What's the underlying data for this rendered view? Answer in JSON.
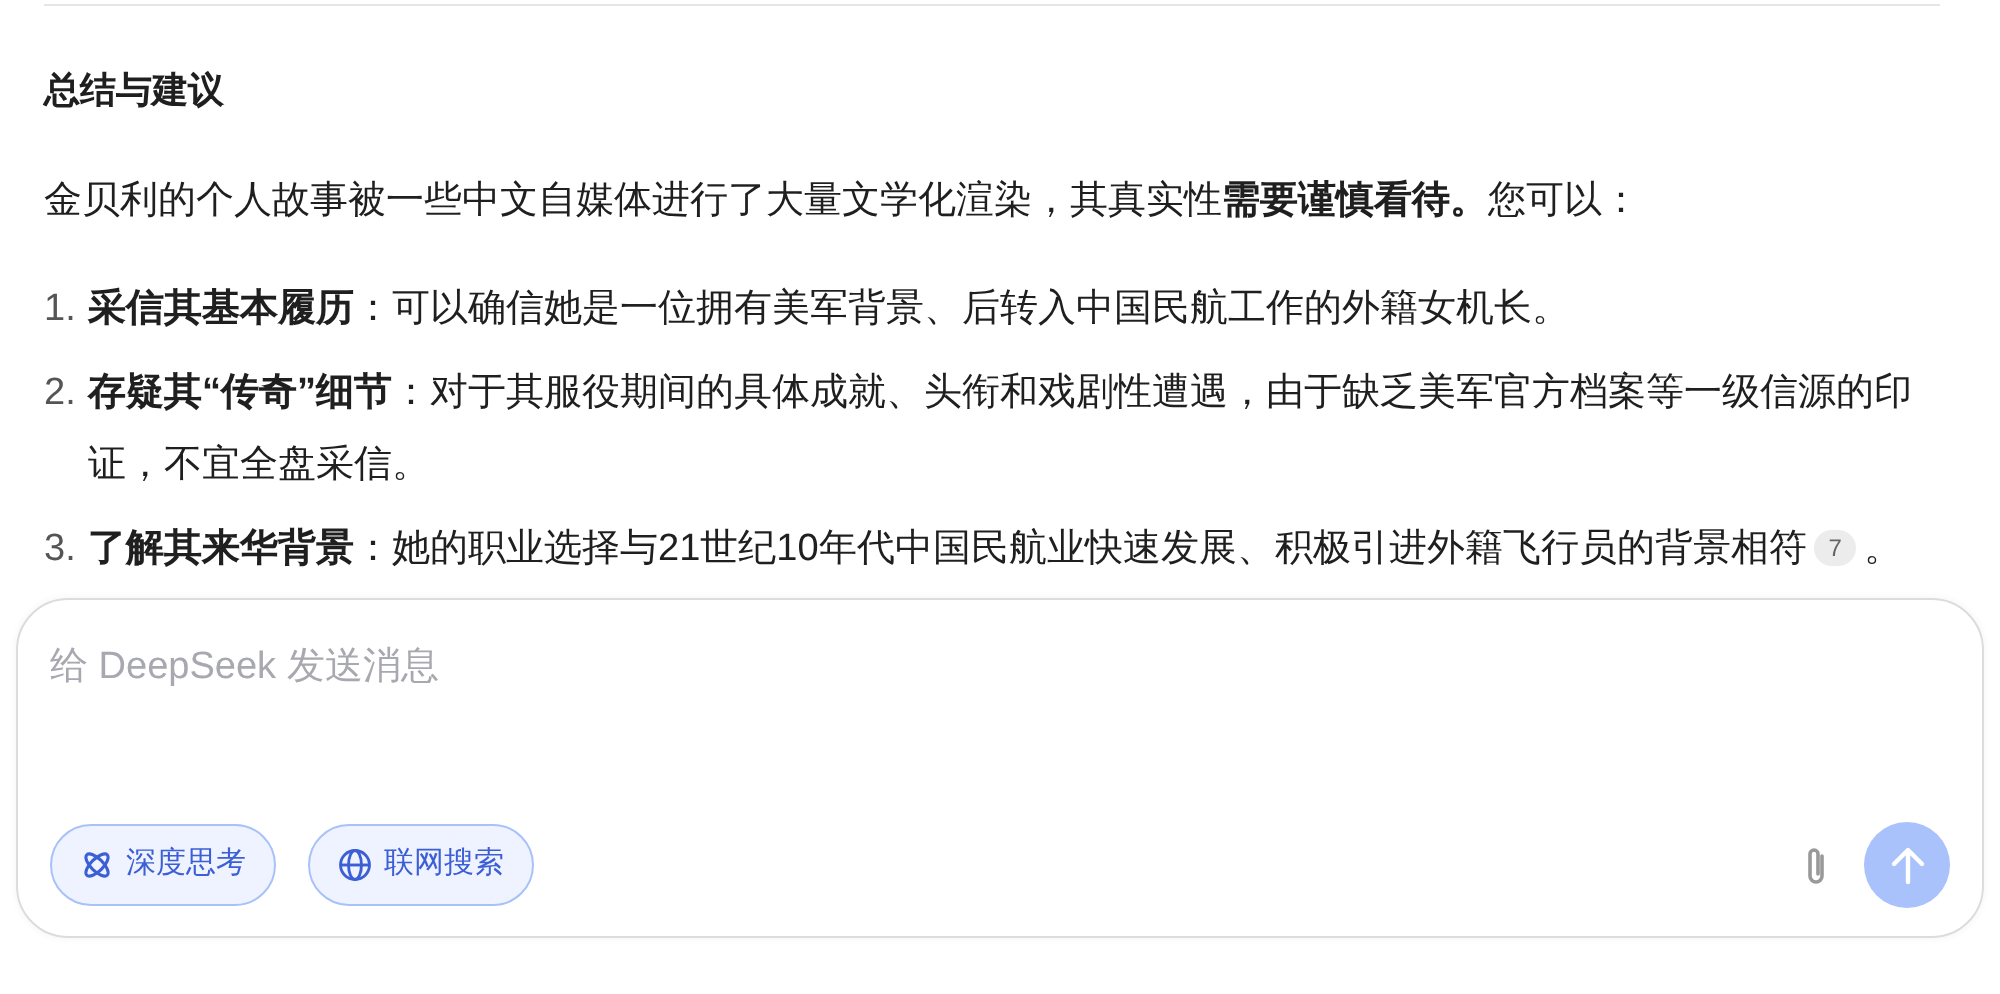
{
  "answer": {
    "heading": "总结与建议",
    "intro": "金贝利的个人故事被一些中文自媒体进行了大量文学化渲染，其真实性**需要谨慎看待。**您可以：",
    "items": [
      {
        "number": "1.",
        "title": "采信其基本履历",
        "text": "：可以确信她是一位拥有美军背景、后转入中国民航工作的外籍女机长。"
      },
      {
        "number": "2.",
        "title": "存疑其“传奇”细节",
        "text": "：对于其服役期间的具体成就、头衔和戏剧性遭遇，由于缺乏美军官方档案等一级信源的印证，不宜全盘采信。"
      },
      {
        "number": "3.",
        "title": "了解其来华背景",
        "text": "：她的职业选择与21世纪10年代中国民航业快速发展、积极引进外籍飞行员的背景相符",
        "citation": "7",
        "after": "。"
      }
    ]
  },
  "composer": {
    "placeholder": "给 DeepSeek 发送消息",
    "toggles": [
      {
        "kind": "think",
        "label": "深度思考",
        "selected": true
      },
      {
        "kind": "search",
        "label": "联网搜索",
        "selected": true
      }
    ],
    "send": {
      "disabled": true
    }
  }
}
